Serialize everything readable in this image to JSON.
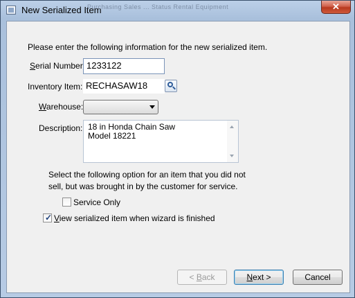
{
  "window": {
    "title": "New Serialized Item",
    "close_label": "✕",
    "background_text": "Purchasing   Sales     ...     Status   Rental Equipment"
  },
  "form": {
    "intro": "Please enter the following information for the new serialized item.",
    "serial_label_key": "S",
    "serial_label_rest": "erial Number:",
    "serial_value": "1233122",
    "inventory_label": "Inventory Item:",
    "inventory_value": "RECHASAW18",
    "warehouse_label_key": "W",
    "warehouse_label_rest": "arehouse:",
    "warehouse_value": "",
    "description_label": "Description:",
    "description_line1": "18 in Honda Chain Saw",
    "description_line2": "Model 18221",
    "note_line1": "Select the following option for an item that you did not",
    "note_line2": "sell, but was brought in by the customer for service.",
    "service_only_label": "Service Only",
    "service_only_checked": false,
    "view_item_key": "V",
    "view_item_rest": "iew serialized item when wizard is finished",
    "view_item_checked": true
  },
  "buttons": {
    "back_key": "B",
    "back_prefix": "< ",
    "back_rest": "ack",
    "next_key": "N",
    "next_rest": "ext >",
    "cancel": "Cancel"
  },
  "colors": {
    "accent": "#3c7fb1",
    "close_red": "#c8452a",
    "titlebar": "#b7cbe4"
  }
}
